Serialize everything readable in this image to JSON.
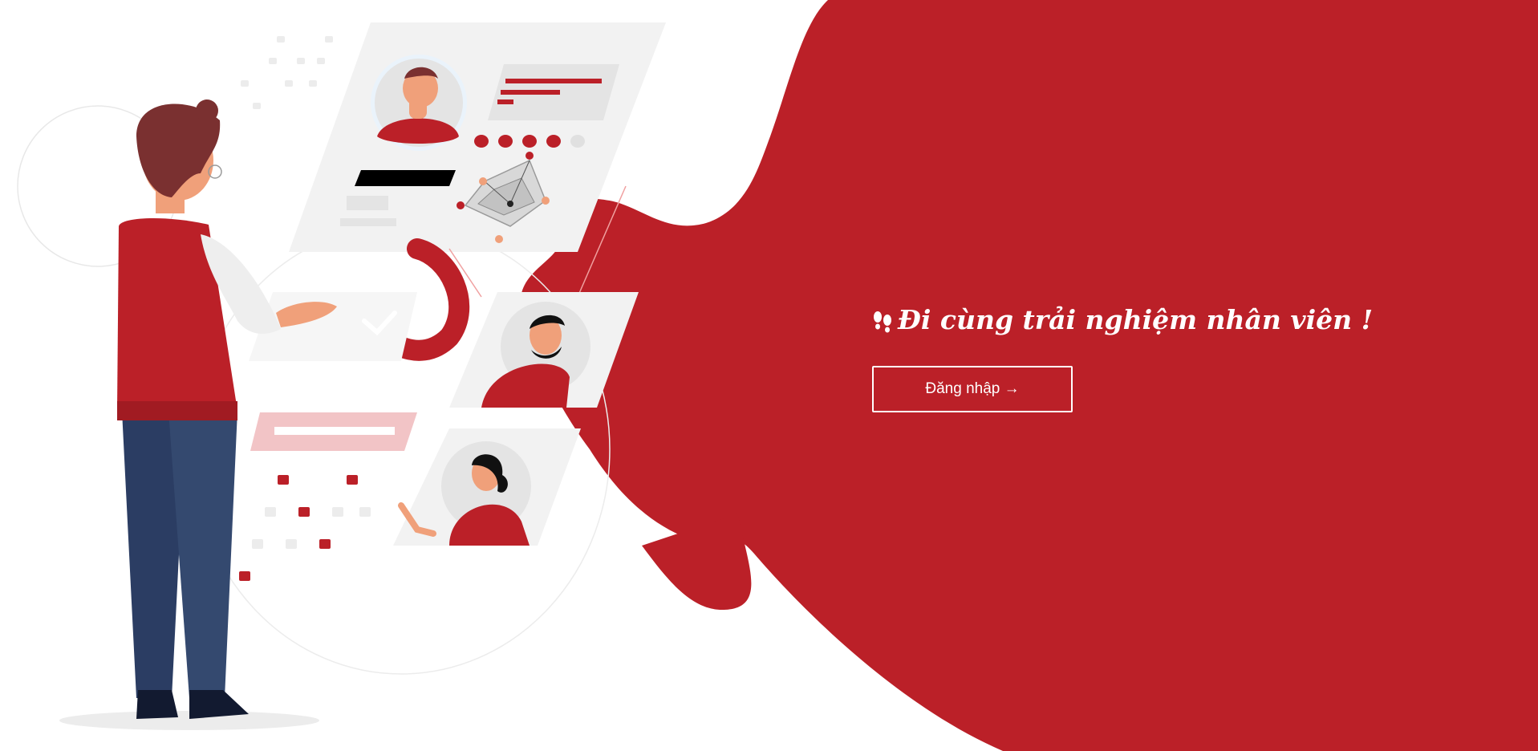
{
  "hero": {
    "tagline": "Đi cùng trải nghiệm nhân viên !",
    "tagline_icon": "footprints-icon",
    "login_label": "Đăng nhập →"
  },
  "colors": {
    "brand_red": "#bb2028",
    "light_gray": "#f2f2f2",
    "mid_gray": "#e4e4e4",
    "navy": "#2b3d63",
    "skin": "#f0a07a",
    "hair": "#7a3030"
  }
}
